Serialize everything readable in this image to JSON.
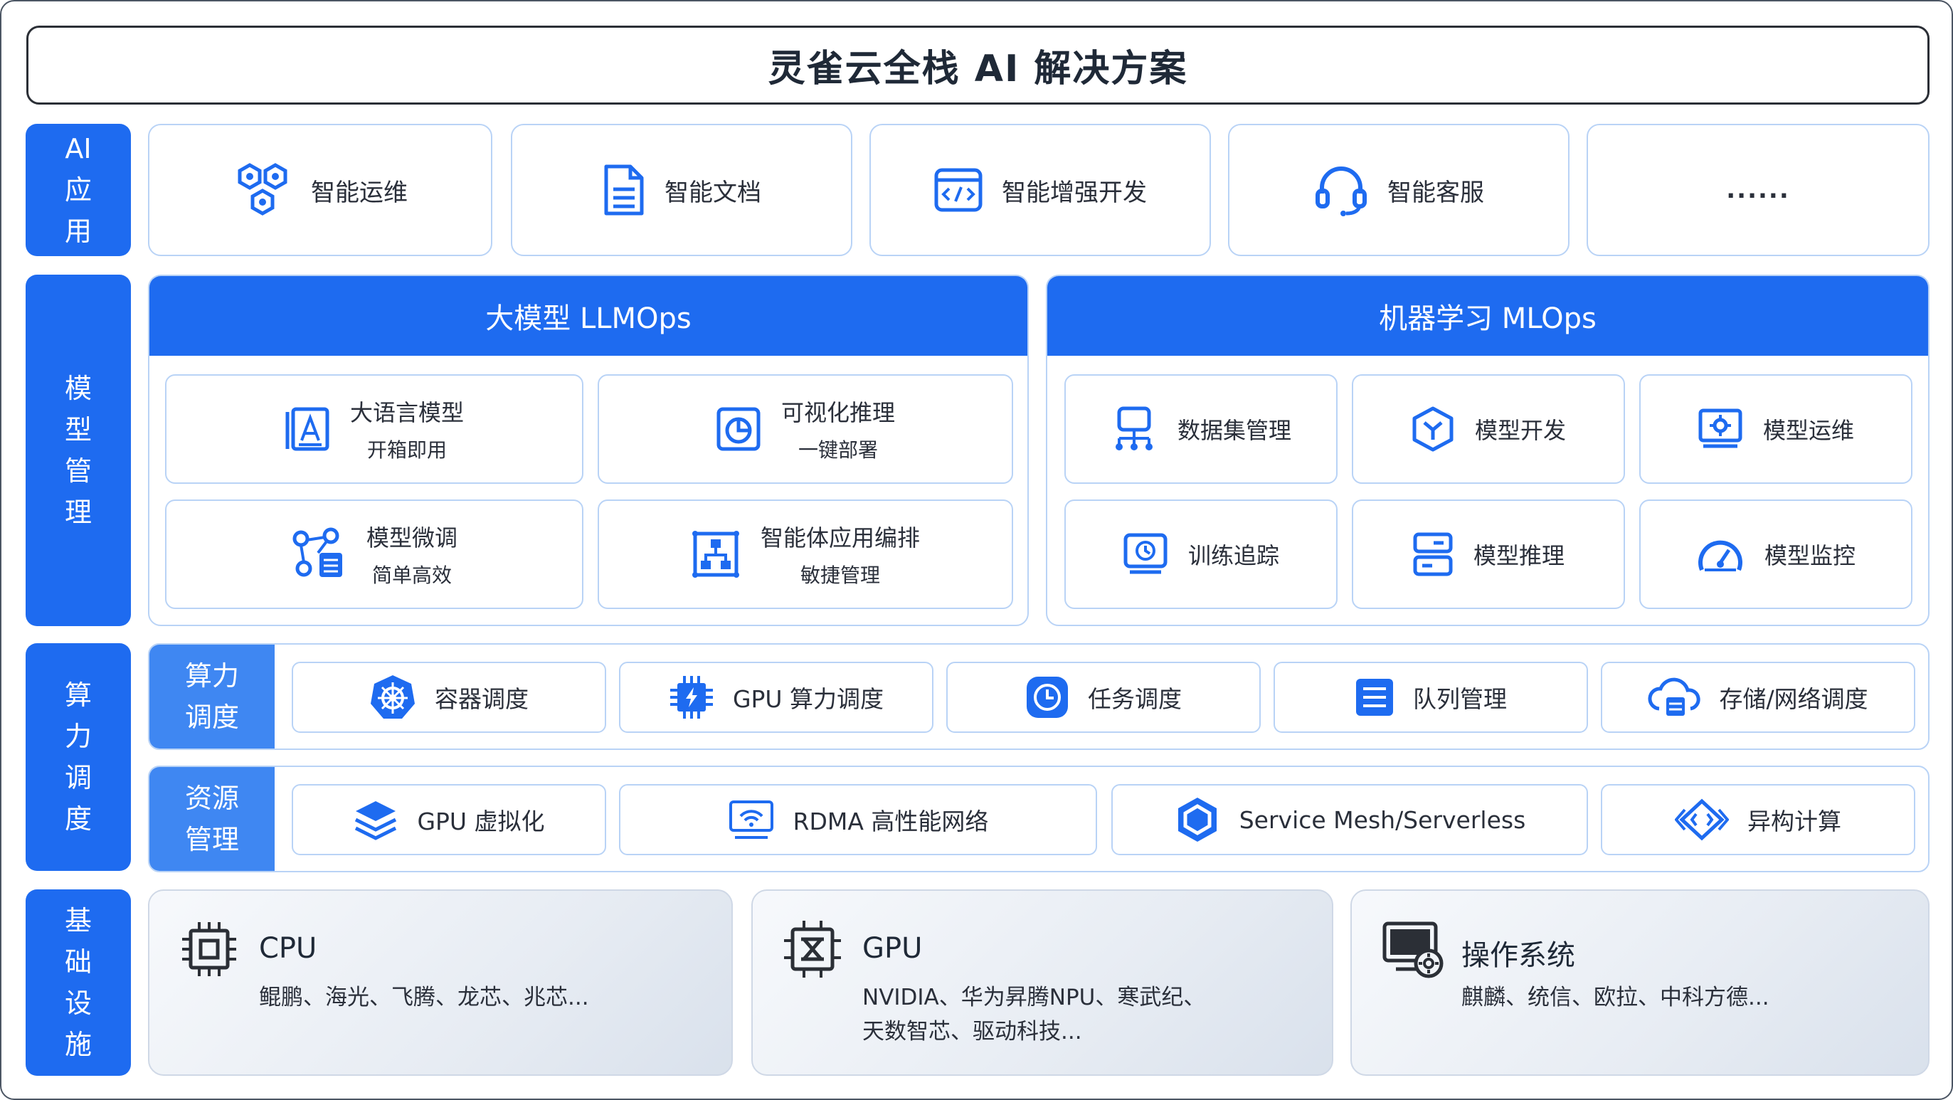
{
  "title": "灵雀云全栈 AI 解决方案",
  "side_labels": {
    "ai_app": "AI应用",
    "model_mgmt": "模型管理",
    "compute": "算力调度",
    "infra": "基础设施"
  },
  "ai_apps": [
    {
      "label": "智能运维",
      "icon": "hexagon-cluster-icon"
    },
    {
      "label": "智能文档",
      "icon": "document-icon"
    },
    {
      "label": "智能增强开发",
      "icon": "code-window-icon"
    },
    {
      "label": "智能客服",
      "icon": "headset-icon"
    },
    {
      "label": "......",
      "icon": ""
    }
  ],
  "llmops": {
    "title": "大模型 LLMOps",
    "items": [
      {
        "t1": "大语言模型",
        "t2": "开箱即用",
        "icon": "book-a-icon"
      },
      {
        "t1": "可视化推理",
        "t2": "一键部署",
        "icon": "pie-chart-icon"
      },
      {
        "t1": "模型微调",
        "t2": "简单高效",
        "icon": "network-tune-icon"
      },
      {
        "t1": "智能体应用编排",
        "t2": "敏捷管理",
        "icon": "org-chart-icon"
      }
    ]
  },
  "mlops": {
    "title": "机器学习 MLOps",
    "items": [
      {
        "label": "数据集管理",
        "icon": "dataset-tree-icon"
      },
      {
        "label": "模型开发",
        "icon": "cube-hex-icon"
      },
      {
        "label": "模型运维",
        "icon": "gear-monitor-icon"
      },
      {
        "label": "训练追踪",
        "icon": "clock-monitor-icon"
      },
      {
        "label": "模型推理",
        "icon": "server-icon"
      },
      {
        "label": "模型监控",
        "icon": "gauge-icon"
      }
    ]
  },
  "compute_sched": {
    "tag": "算力调度",
    "items": [
      {
        "label": "容器调度",
        "icon": "helm-wheel-icon"
      },
      {
        "label": "GPU 算力调度",
        "icon": "chip-bolt-icon"
      },
      {
        "label": "任务调度",
        "icon": "clock-icon"
      },
      {
        "label": "队列管理",
        "icon": "list-icon"
      },
      {
        "label": "存储/网络调度",
        "icon": "cloud-storage-icon"
      }
    ]
  },
  "resource_mgmt": {
    "tag": "资源管理",
    "items": [
      {
        "label": "GPU 虚拟化",
        "icon": "layers-icon"
      },
      {
        "label": "RDMA 高性能网络",
        "icon": "wifi-monitor-icon"
      },
      {
        "label": "Service Mesh/Serverless",
        "icon": "hexagon-mesh-icon"
      },
      {
        "label": "异构计算",
        "icon": "diamond-code-icon"
      }
    ]
  },
  "infra": [
    {
      "name": "CPU",
      "desc": "鲲鹏、海光、飞腾、龙芯、兆芯...",
      "icon": "cpu-icon"
    },
    {
      "name": "GPU",
      "desc": "NVIDIA、华为昇腾NPU、寒武纪、",
      "desc2": "天数智芯、驱动科技...",
      "icon": "gpu-icon"
    },
    {
      "name": "操作系统",
      "desc": "麒麟、统信、欧拉、中科方德...",
      "icon": "os-monitor-icon"
    }
  ],
  "colors": {
    "primary": "#1e6bf0",
    "tag": "#3f87f2",
    "border": "#b9d3f6",
    "text": "#2a2f3a"
  }
}
